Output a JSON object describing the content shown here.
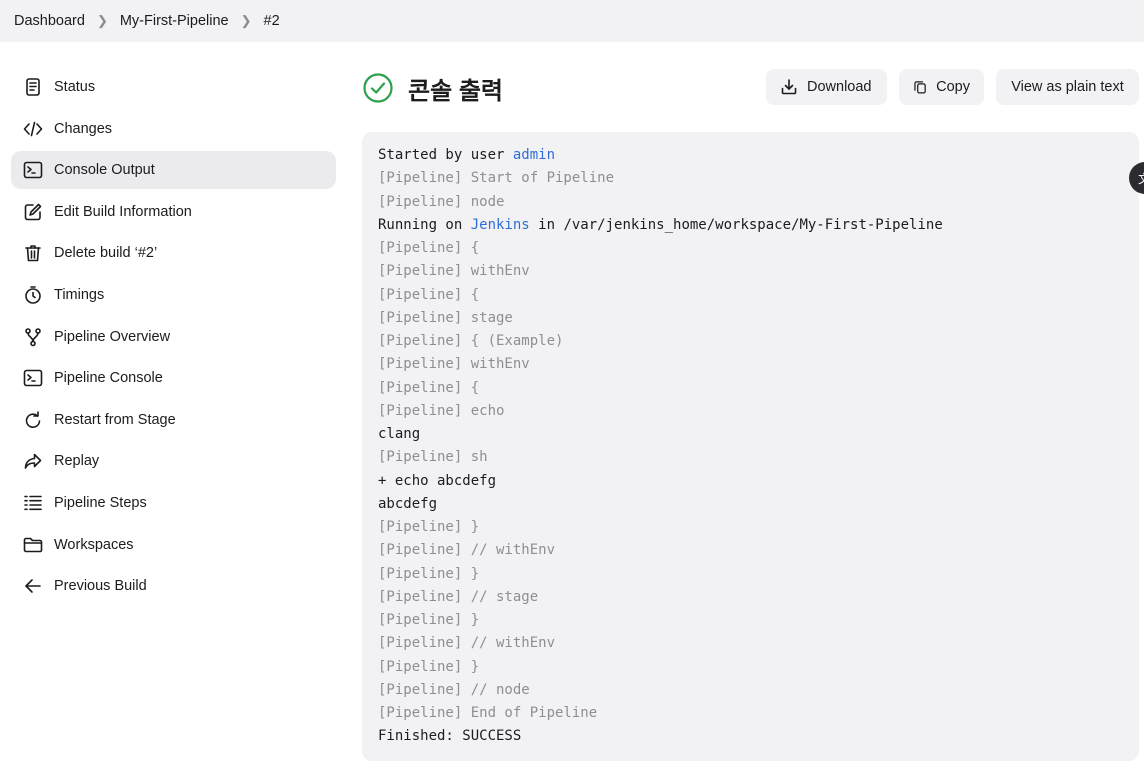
{
  "breadcrumb": [
    {
      "label": "Dashboard"
    },
    {
      "label": "My-First-Pipeline"
    },
    {
      "label": "#2"
    }
  ],
  "sidebar": {
    "items": [
      {
        "label": "Status",
        "icon": "document-icon"
      },
      {
        "label": "Changes",
        "icon": "code-icon"
      },
      {
        "label": "Console Output",
        "icon": "terminal-icon",
        "active": true
      },
      {
        "label": "Edit Build Information",
        "icon": "edit-icon"
      },
      {
        "label": "Delete build ‘#2’",
        "icon": "trash-icon"
      },
      {
        "label": "Timings",
        "icon": "stopwatch-icon"
      },
      {
        "label": "Pipeline Overview",
        "icon": "branch-icon"
      },
      {
        "label": "Pipeline Console",
        "icon": "terminal-icon"
      },
      {
        "label": "Restart from Stage",
        "icon": "restart-icon"
      },
      {
        "label": "Replay",
        "icon": "replay-icon"
      },
      {
        "label": "Pipeline Steps",
        "icon": "list-icon"
      },
      {
        "label": "Workspaces",
        "icon": "folder-icon"
      },
      {
        "label": "Previous Build",
        "icon": "arrow-left-icon"
      }
    ]
  },
  "header": {
    "title": "콘솔 출력",
    "status_icon": "success-check-icon",
    "status_color": "#2e9f4a"
  },
  "actions": {
    "download_label": "Download",
    "copy_label": "Copy",
    "plain_text_label": "View as plain text"
  },
  "console": {
    "lines": [
      {
        "style": "normal",
        "before": "Started by user ",
        "link": "admin",
        "after": ""
      },
      {
        "style": "dim",
        "text": "[Pipeline] Start of Pipeline"
      },
      {
        "style": "dim",
        "text": "[Pipeline] node"
      },
      {
        "style": "normal",
        "before": "Running on ",
        "link": "Jenkins",
        "after": " in /var/jenkins_home/workspace/My-First-Pipeline"
      },
      {
        "style": "dim",
        "text": "[Pipeline] {"
      },
      {
        "style": "dim",
        "text": "[Pipeline] withEnv"
      },
      {
        "style": "dim",
        "text": "[Pipeline] {"
      },
      {
        "style": "dim",
        "text": "[Pipeline] stage"
      },
      {
        "style": "dim",
        "text": "[Pipeline] { (Example)"
      },
      {
        "style": "dim",
        "text": "[Pipeline] withEnv"
      },
      {
        "style": "dim",
        "text": "[Pipeline] {"
      },
      {
        "style": "dim",
        "text": "[Pipeline] echo"
      },
      {
        "style": "normal",
        "text": "clang"
      },
      {
        "style": "dim",
        "text": "[Pipeline] sh"
      },
      {
        "style": "normal",
        "text": "+ echo abcdefg"
      },
      {
        "style": "normal",
        "text": "abcdefg"
      },
      {
        "style": "dim",
        "text": "[Pipeline] }"
      },
      {
        "style": "dim",
        "text": "[Pipeline] // withEnv"
      },
      {
        "style": "dim",
        "text": "[Pipeline] }"
      },
      {
        "style": "dim",
        "text": "[Pipeline] // stage"
      },
      {
        "style": "dim",
        "text": "[Pipeline] }"
      },
      {
        "style": "dim",
        "text": "[Pipeline] // withEnv"
      },
      {
        "style": "dim",
        "text": "[Pipeline] }"
      },
      {
        "style": "dim",
        "text": "[Pipeline] // node"
      },
      {
        "style": "dim",
        "text": "[Pipeline] End of Pipeline"
      },
      {
        "style": "normal",
        "text": "Finished: SUCCESS"
      }
    ]
  },
  "floating": {
    "label": "文"
  },
  "colors": {
    "link": "#2f6ed8",
    "dim_text": "#8e8e93",
    "panel": "#f2f2f4"
  }
}
